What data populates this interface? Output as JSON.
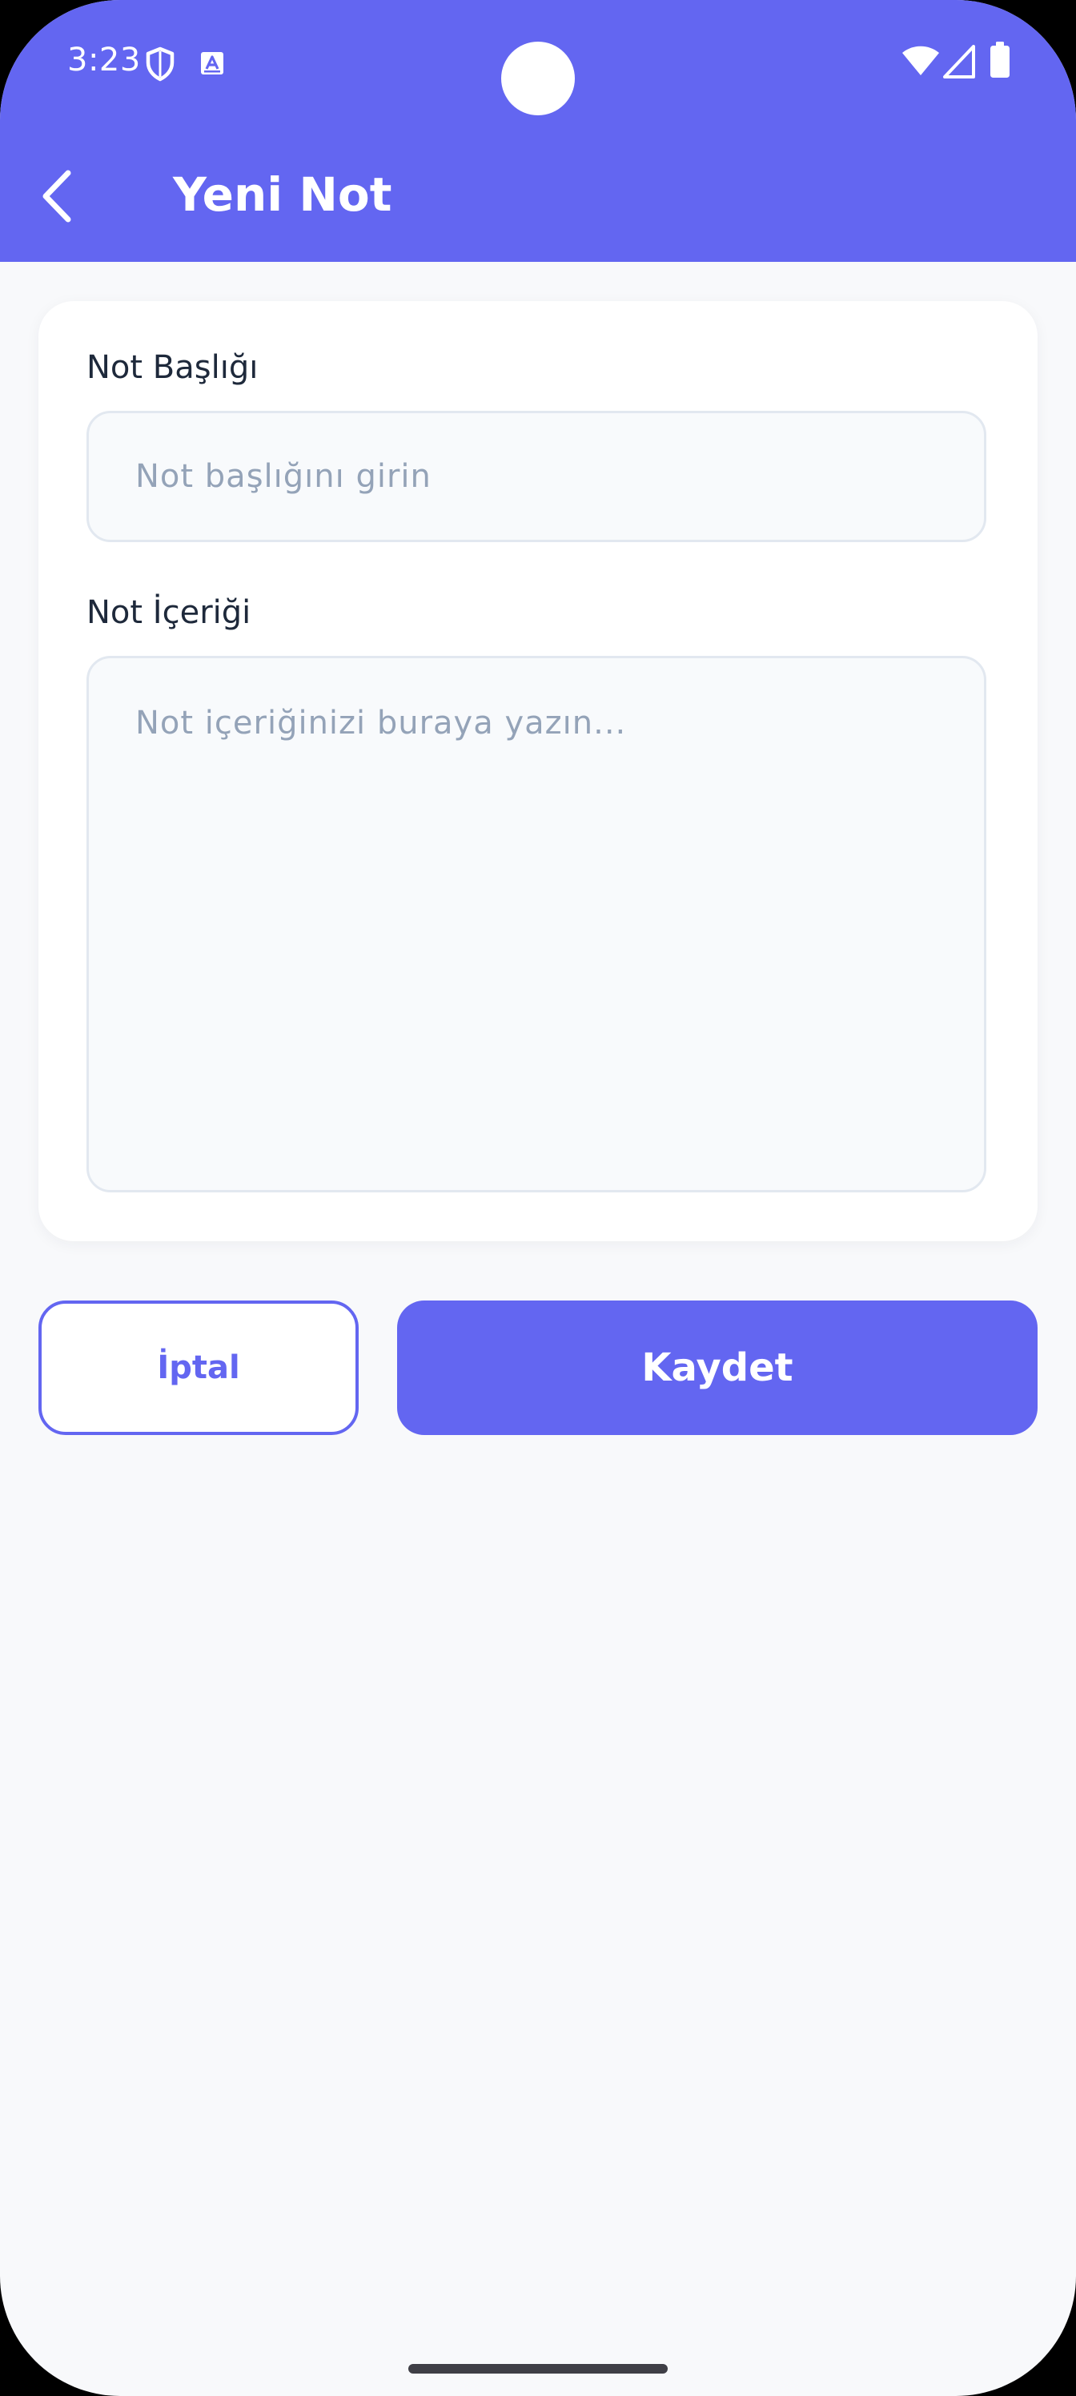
{
  "status_bar": {
    "time": "3:23",
    "left_icons": [
      "shield-icon",
      "text-badge-icon"
    ],
    "right_icons": [
      "wifi-icon",
      "signal-icon",
      "battery-icon"
    ]
  },
  "app_bar": {
    "title": "Yeni Not",
    "back_icon": "chevron-left-icon"
  },
  "form": {
    "title_label": "Not Başlığı",
    "title_value": "",
    "title_placeholder": "Not başlığını girin",
    "content_label": "Not İçeriği",
    "content_value": "",
    "content_placeholder": "Not içeriğinizi buraya yazın..."
  },
  "actions": {
    "cancel_label": "İptal",
    "save_label": "Kaydet"
  },
  "colors": {
    "primary": "#6366F1",
    "background": "#F8F9FB",
    "card": "#FFFFFF",
    "label_text": "#1E293B",
    "placeholder_text": "#94A3B8",
    "input_border": "#E2E8F0"
  }
}
